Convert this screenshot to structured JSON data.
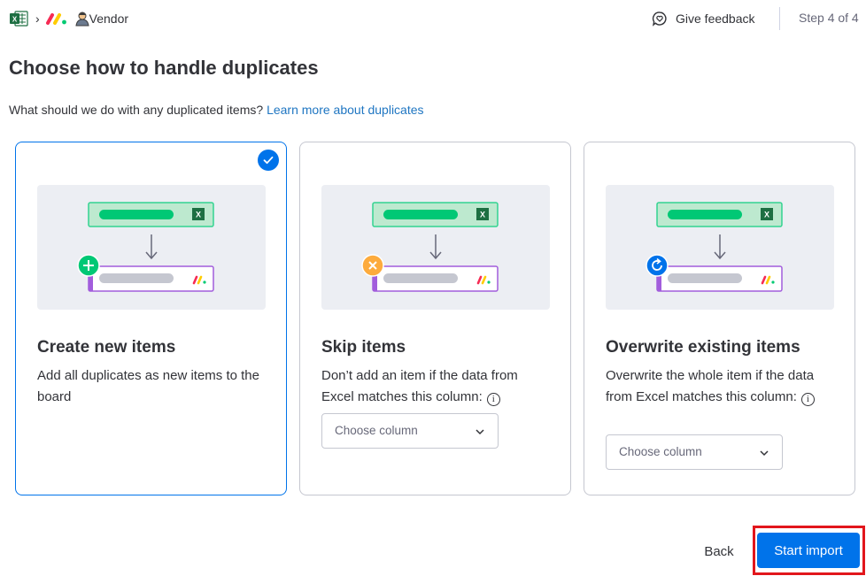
{
  "header": {
    "breadcrumb": {
      "source_icon": "excel-icon",
      "separator_icon": "chevron-right-icon",
      "app_icon": "monday-logo-icon",
      "board_icon": "vendor-person-icon",
      "board_name": "Vendor"
    },
    "feedback_label": "Give feedback",
    "feedback_icon": "feedback-chat-icon",
    "step_label": "Step 4 of 4"
  },
  "page": {
    "title": "Choose how to handle duplicates",
    "subtitle": "What should we do with any duplicated items?",
    "learn_more": "Learn more about duplicates"
  },
  "options": [
    {
      "title": "Create new items",
      "description": "Add all duplicates as new items to the board",
      "selected": true,
      "badge_icon": "plus-icon",
      "badge_color": "#00c875"
    },
    {
      "title": "Skip items",
      "description": "Don’t add an item if the data from Excel matches this column:",
      "selected": false,
      "badge_icon": "x-icon",
      "badge_color": "#fdab3d",
      "select_placeholder": "Choose column"
    },
    {
      "title": "Overwrite existing items",
      "description": "Overwrite the whole item if the data from Excel matches this column:",
      "selected": false,
      "badge_icon": "refresh-icon",
      "badge_color": "#0073ea",
      "select_placeholder": "Choose column"
    }
  ],
  "footer": {
    "back_label": "Back",
    "start_label": "Start import"
  },
  "colors": {
    "primary": "#0073ea",
    "link": "#1f76c2",
    "excel_green": "#1d6f42",
    "highlight_outline": "#e2161c"
  }
}
